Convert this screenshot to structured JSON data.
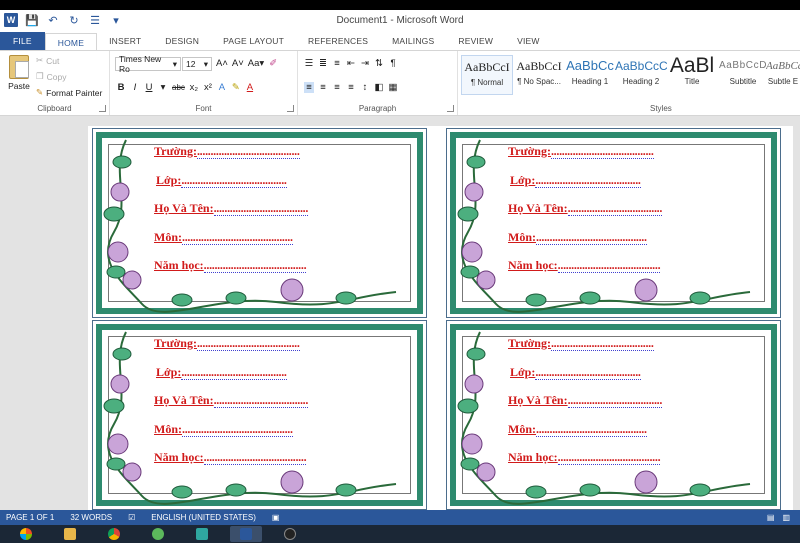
{
  "window": {
    "title": "Document1 - Microsoft Word"
  },
  "tabs": [
    "FILE",
    "HOME",
    "INSERT",
    "DESIGN",
    "PAGE LAYOUT",
    "REFERENCES",
    "MAILINGS",
    "REVIEW",
    "VIEW"
  ],
  "active_tab": "HOME",
  "clipboard": {
    "paste": "Paste",
    "cut": "Cut",
    "copy": "Copy",
    "format_painter": "Format Painter",
    "label": "Clipboard"
  },
  "font": {
    "name": "Times New Ro",
    "size": "12",
    "label": "Font"
  },
  "paragraph": {
    "label": "Paragraph"
  },
  "styles": {
    "label": "Styles",
    "items": [
      {
        "sample": "AaBbCcI",
        "name": "¶ Normal"
      },
      {
        "sample": "AaBbCcI",
        "name": "¶ No Spac..."
      },
      {
        "sample": "AaBbCc",
        "name": "Heading 1"
      },
      {
        "sample": "AaBbCcC",
        "name": "Heading 2"
      },
      {
        "sample": "AaBl",
        "name": "Title"
      },
      {
        "sample": "AaBbCcD",
        "name": "Subtitle"
      },
      {
        "sample": "AaBbCcE",
        "name": "Subtle E"
      }
    ]
  },
  "card_fields": [
    {
      "label": "Trường:",
      "dots": "......................................"
    },
    {
      "label": "Lớp:",
      "dots": "......................................."
    },
    {
      "label": "Họ Và Tên:",
      "dots": "..................................."
    },
    {
      "label": "Môn:",
      "dots": "........................................."
    },
    {
      "label": "Năm học:",
      "dots": "......................................"
    }
  ],
  "status": {
    "page": "PAGE 1 OF 1",
    "words": "32 WORDS",
    "language": "ENGLISH (UNITED STATES)"
  },
  "colors": {
    "accent": "#2b579a",
    "frame": "#2e8b6f",
    "field_text": "#d11a1a"
  }
}
